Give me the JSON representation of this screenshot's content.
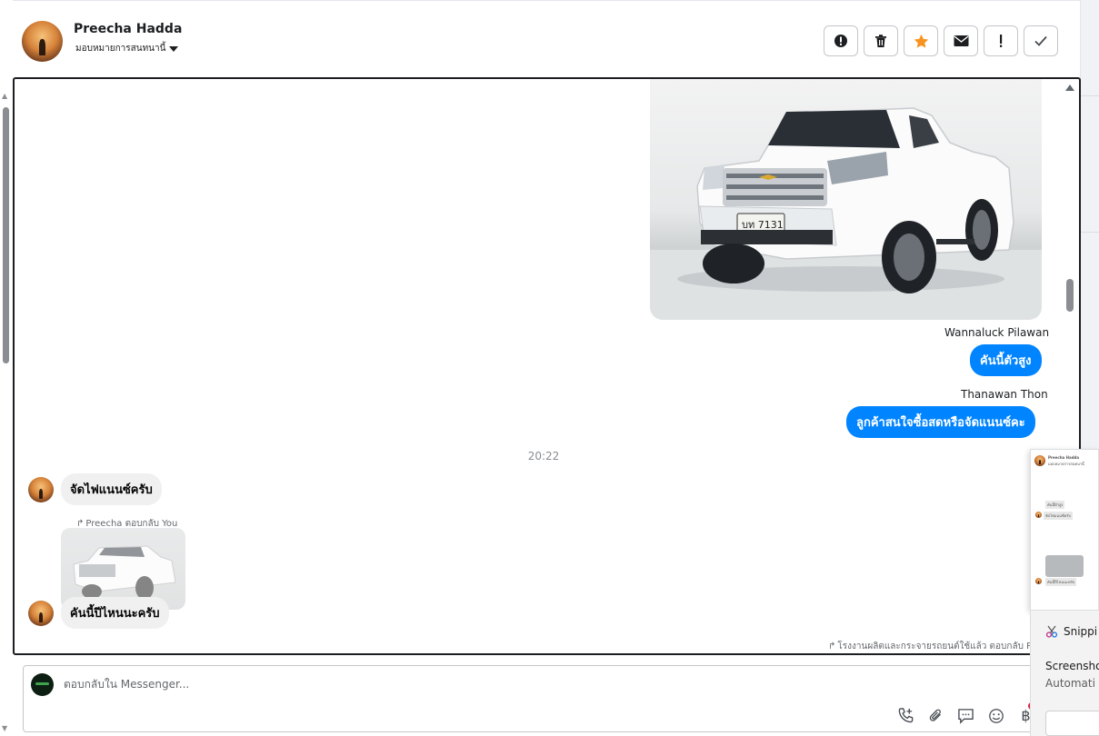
{
  "header": {
    "contact_name": "Preecha Hadda",
    "assign_label": "มอบหมายการสนทนานี้",
    "actions": [
      "alert-circle-icon",
      "trash-icon",
      "star-icon",
      "mail-icon",
      "exclamation-icon",
      "check-icon"
    ]
  },
  "colors": {
    "outgoing_bubble": "#0084ff",
    "incoming_bubble": "#f0f0f0",
    "star": "#f7931e"
  },
  "messages": {
    "sender_1": "Wannaluck Pilawan",
    "bubble_1": "คันนี้ตัวสูง",
    "sender_2": "Thanawan Thon",
    "bubble_2": "ลูกค้าสนใจซื้อสดหรือจัดแนนซ์คะ",
    "timestamp": "20:22",
    "incoming_1": "จัดไฟแนนซ์ครับ",
    "reply_note": "Preecha ตอบกลับ You",
    "incoming_2": "คันนี้ปีไหนนะครับ",
    "bottom_note": "โรงงานผลิตและกระจายรถยนต์ใช้แล้ว ตอบกลับ Preec",
    "plate_text": "บท 7131"
  },
  "composer": {
    "placeholder": "ตอบกลับใน Messenger...",
    "tools": [
      "phone-plus-icon",
      "paperclip-icon",
      "chat-bubble-icon",
      "smiley-icon",
      "baht-icon"
    ],
    "baht_symbol": "฿"
  },
  "preview": {
    "name": "Preecha Hadda",
    "line_1": "มอบหมายการสนทนานี้",
    "bubble": "คันนี้ตัวสูง",
    "reply": "จัดไฟแนนซ์ครับ",
    "msg": "คันนี้ปีไหนนะครับ"
  },
  "toast": {
    "app": "Snippi",
    "title": "Screensho",
    "subtitle": "Automati"
  }
}
